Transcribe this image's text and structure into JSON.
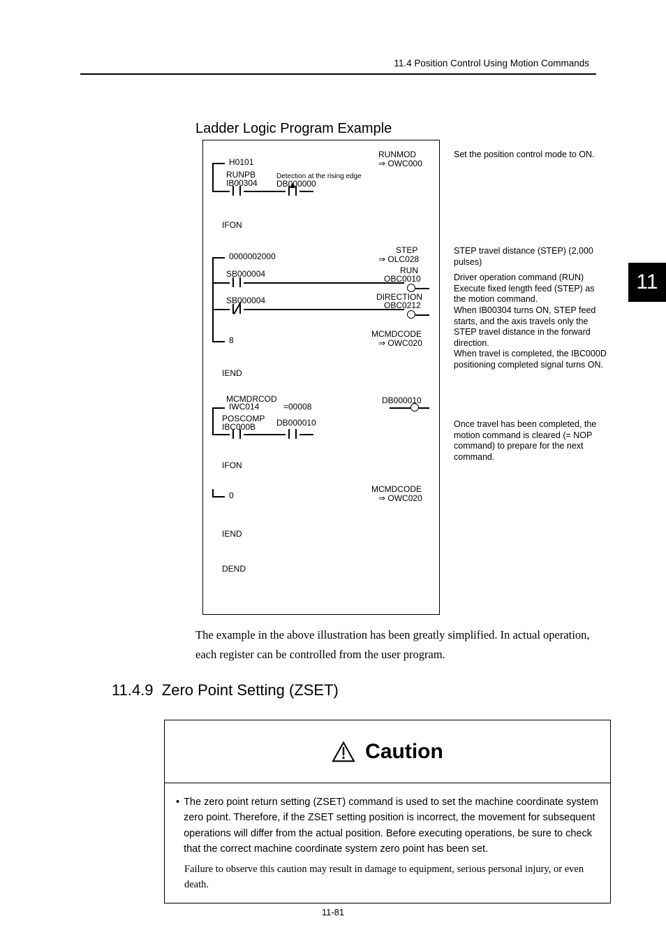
{
  "header": {
    "breadcrumb": "11.4  Position Control Using Motion Commands"
  },
  "chapterTab": "11",
  "section_heading": "Ladder Logic Program Example",
  "diagram": {
    "block1": {
      "h_val": "H0101",
      "runmod": "RUNMOD",
      "runmod_dst": "⇒ OWC000",
      "runpb": "RUNPB",
      "ib": "IB00304",
      "edge_label": "Detection at the rising edge",
      "db": "DB000000"
    },
    "annot1": "Set the position control mode to ON.",
    "ifon1": "IFON",
    "block2": {
      "val": "0000002000",
      "step": "STEP",
      "step_dst": "⇒ OLC028",
      "sb1": "SB000004",
      "run": "RUN",
      "run_dst": "OBC0010",
      "sb2": "SB000004",
      "dir": "DIRECTION",
      "dir_dst": "OBC0212",
      "eight": "8",
      "mcmd": "MCMDCODE",
      "mcmd_dst": "⇒ OWC020"
    },
    "annot2a": "STEP travel distance (STEP) (2,000 pulses)",
    "annot2b": "Driver operation command (RUN) Execute fixed length feed (STEP) as the motion command.\nWhen IB00304 turns ON, STEP feed starts, and the axis travels only the STEP travel distance in the forward direction.\nWhen travel is completed, the IBC000D positioning completed signal turns ON.",
    "iend1": "IEND",
    "block3": {
      "mcmdrcod": "MCMDRCOD",
      "iwc": "IWC014",
      "eq": "=00008",
      "db_out": "DB000010",
      "poscomp": "POSCOMP",
      "ibc": "IBC000B",
      "db_in": "DB000010"
    },
    "annot3": "Once travel has been completed, the motion command is cleared (= NOP command) to prepare for the next command.",
    "ifon2": "IFON",
    "block4": {
      "zero": "0",
      "mcmd": "MCMDCODE",
      "mcmd_dst": "⇒ OWC020"
    },
    "iend2": "IEND",
    "dend": "DEND"
  },
  "body_text": "The example in the above illustration has been greatly simplified. In actual operation, each register can be controlled from the user program.",
  "subsection": {
    "number": "11.4.9",
    "title": "Zero Point Setting (ZSET)"
  },
  "caution": {
    "title": "Caution",
    "bullet": "The zero point return setting (ZSET) command is used to set the machine coordinate system zero point. Therefore, if the ZSET setting position is incorrect, the movement for subsequent operations will differ from the actual position. Before executing operations, be sure to check that the correct machine coordinate system zero point has been set.",
    "note": "Failure to observe this caution may result in damage to equipment, serious personal injury, or even death."
  },
  "pagenum": "11-81"
}
